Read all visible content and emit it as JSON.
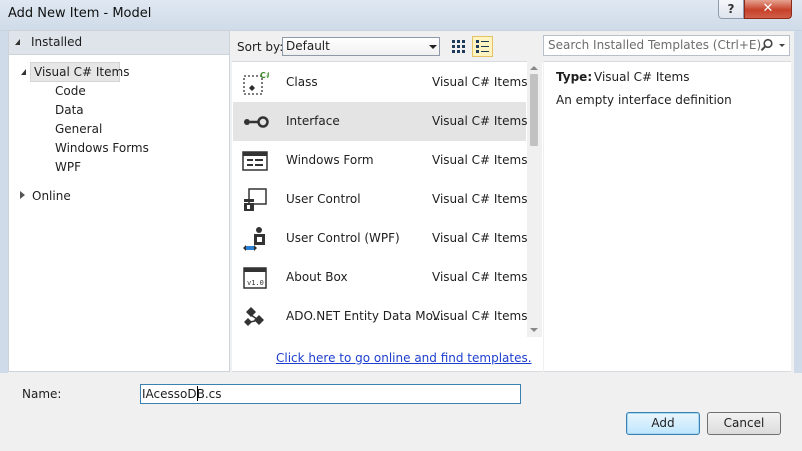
{
  "window": {
    "title": "Add New Item - Model",
    "help_glyph": "?",
    "close_glyph": "✕"
  },
  "left_pane": {
    "installed_label": "Installed",
    "selected_node": "Visual C# Items",
    "children": [
      "Code",
      "Data",
      "General",
      "Windows Forms",
      "WPF"
    ],
    "online_label": "Online"
  },
  "toolbar": {
    "sort_label": "Sort by:",
    "sort_value": "Default",
    "search_placeholder": "Search Installed Templates (Ctrl+E)",
    "search_icon_glyph": "⚲"
  },
  "templates": [
    {
      "name": "Class",
      "type": "Visual C# Items",
      "icon": "class-icon",
      "selected": false
    },
    {
      "name": "Interface",
      "type": "Visual C# Items",
      "icon": "interface-icon",
      "selected": true
    },
    {
      "name": "Windows Form",
      "type": "Visual C# Items",
      "icon": "windows-form-icon",
      "selected": false
    },
    {
      "name": "User Control",
      "type": "Visual C# Items",
      "icon": "user-control-icon",
      "selected": false
    },
    {
      "name": "User Control (WPF)",
      "type": "Visual C# Items",
      "icon": "user-control-wpf-icon",
      "selected": false
    },
    {
      "name": "About Box",
      "type": "Visual C# Items",
      "icon": "about-box-icon",
      "selected": false
    },
    {
      "name": "ADO.NET Entity Data Mo...",
      "type": "Visual C# Items",
      "icon": "entity-data-model-icon",
      "selected": false
    }
  ],
  "online_link": "Click here to go online and find templates.",
  "details": {
    "type_label": "Type:",
    "type_value": "Visual C# Items",
    "description": "An empty interface definition"
  },
  "bottom": {
    "name_label": "Name:",
    "name_value": "IAcessoDB.cs",
    "add_label": "Add",
    "cancel_label": "Cancel"
  },
  "colors": {
    "selected_row": "#e4e4e4",
    "link": "#1d3fd0",
    "focus_border": "#3c7fb1",
    "close_button": "#c7412a"
  }
}
